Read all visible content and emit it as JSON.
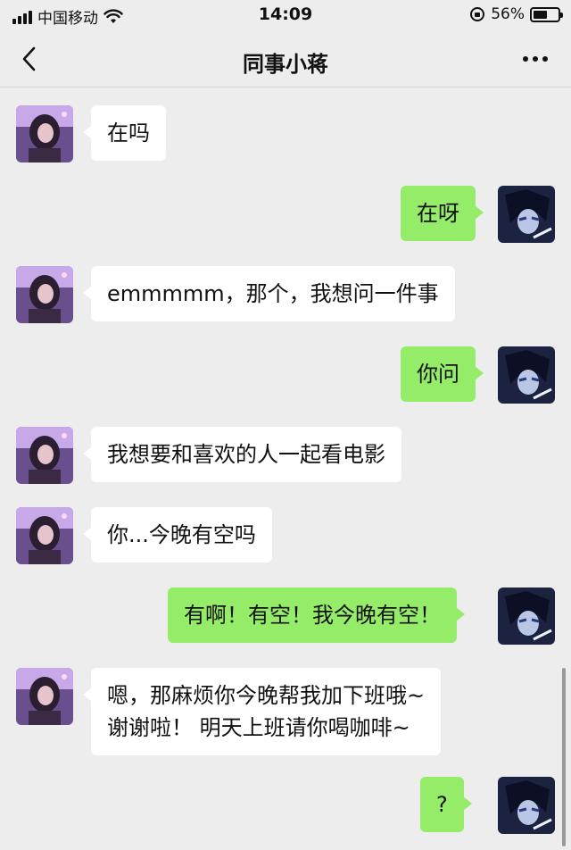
{
  "status_bar": {
    "carrier": "中国移动",
    "time": "14:09",
    "battery": "56%",
    "battery_level": 0.56
  },
  "header": {
    "title": "同事小蒋"
  },
  "messages": [
    {
      "from": "them",
      "text": "在吗"
    },
    {
      "from": "me",
      "text": "在呀"
    },
    {
      "from": "them",
      "text": "emmmmm，那个，我想问一件事"
    },
    {
      "from": "me",
      "text": "你问"
    },
    {
      "from": "them",
      "text": "我想要和喜欢的人一起看电影"
    },
    {
      "from": "them",
      "text": "你...今晚有空吗"
    },
    {
      "from": "me",
      "text": "有啊！有空！我今晚有空！"
    },
    {
      "from": "them",
      "lines": [
        "嗯，那麻烦你今晚帮我加下班哦~",
        "谢谢啦！ 明天上班请你喝咖啡~"
      ]
    },
    {
      "from": "me",
      "text": "?"
    }
  ],
  "colors": {
    "background": "#ededed",
    "incoming_bubble": "#ffffff",
    "outgoing_bubble": "#95ec69"
  }
}
